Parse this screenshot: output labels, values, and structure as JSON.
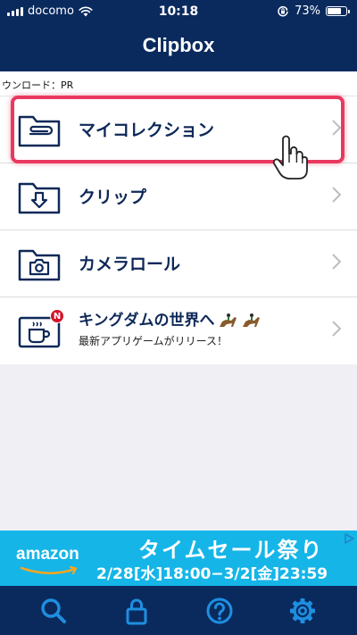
{
  "status_bar": {
    "carrier": "docomo",
    "time": "10:18",
    "battery_percent": "73%",
    "battery_level": 0.73,
    "icons": [
      "signal-icon",
      "wifi-icon",
      "orientation-lock-icon",
      "battery-icon"
    ]
  },
  "nav": {
    "title": "Clipbox"
  },
  "pr_strip": {
    "text": "ウンロード：PR"
  },
  "menu": {
    "items": [
      {
        "label": "マイコレクション",
        "icon": "folder-clip-icon"
      },
      {
        "label": "クリップ",
        "icon": "folder-download-icon"
      },
      {
        "label": "カメラロール",
        "icon": "folder-camera-icon"
      },
      {
        "title": "キングダムの世界へ",
        "subtitle": "最新アプリゲームがリリース！",
        "icon": "game-cup-icon",
        "badge": "N",
        "emoji": "horse-rider-icons"
      }
    ]
  },
  "ad": {
    "brand": "amazon",
    "title": "タイムセール祭り",
    "dates": "2/28[水]18:00−3/2[金]23:59",
    "icon": "adchoices-icon"
  },
  "tabs": [
    {
      "name": "search",
      "icon": "search-icon"
    },
    {
      "name": "lock",
      "icon": "lock-icon"
    },
    {
      "name": "help",
      "icon": "help-icon"
    },
    {
      "name": "settings",
      "icon": "gear-icon"
    }
  ],
  "colors": {
    "navy": "#0a2a5e",
    "highlight": "#e8395f",
    "ad_blue": "#16b5e8",
    "badge_red": "#d2142a"
  }
}
